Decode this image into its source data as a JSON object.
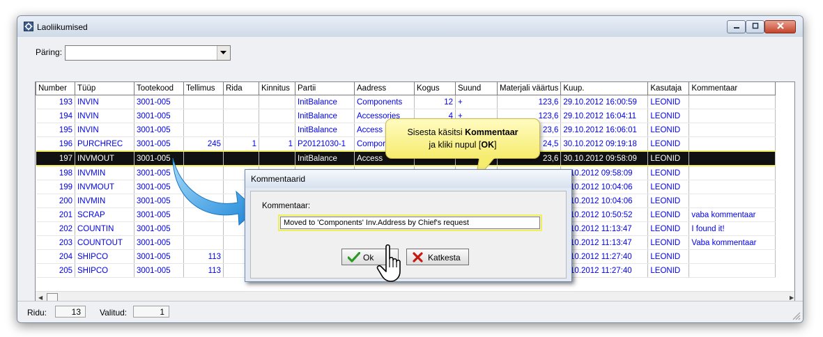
{
  "window": {
    "title": "Laoliikumised"
  },
  "query": {
    "label": "Päring:",
    "value": ""
  },
  "grid": {
    "columns": [
      "Number",
      "Tüüp",
      "Tootekood",
      "Tellimus",
      "Rida",
      "Kinnitus",
      "Partii",
      "Aadress",
      "Kogus",
      "Suund",
      "Materjali väärtus",
      "Kuup.",
      "Kasutaja",
      "Kommentaar"
    ],
    "rows": [
      [
        "193",
        "INVIN",
        "3001-005",
        "",
        "",
        "",
        "InitBalance",
        "Components",
        "12",
        "+",
        "123,6",
        "29.10.2012 16:00:59",
        "LEONID",
        ""
      ],
      [
        "194",
        "INVIN",
        "3001-005",
        "",
        "",
        "",
        "InitBalance",
        "Accessories",
        "4",
        "+",
        "123,6",
        "29.10.2012 16:04:11",
        "LEONID",
        ""
      ],
      [
        "195",
        "INVIN",
        "3001-005",
        "",
        "",
        "",
        "InitBalance",
        "Access",
        "",
        "",
        "23,6",
        "29.10.2012 16:06:01",
        "LEONID",
        ""
      ],
      [
        "196",
        "PURCHREC",
        "3001-005",
        "245",
        "1",
        "1",
        "P20121030-1",
        "Compor",
        "",
        "",
        "24,5",
        "30.10.2012 09:19:18",
        "LEONID",
        ""
      ],
      [
        "197",
        "INVMOUT",
        "3001-005",
        "",
        "",
        "",
        "InitBalance",
        "Access",
        "",
        "",
        "23,6",
        "30.10.2012 09:58:09",
        "LEONID",
        ""
      ],
      [
        "198",
        "INVMIN",
        "3001-005",
        "",
        "",
        "",
        "",
        "",
        "",
        "",
        "",
        "0.10.2012 09:58:09",
        "LEONID",
        ""
      ],
      [
        "199",
        "INVMOUT",
        "3001-005",
        "",
        "",
        "",
        "",
        "",
        "",
        "",
        "",
        "0.10.2012 10:04:06",
        "LEONID",
        ""
      ],
      [
        "200",
        "INVMIN",
        "3001-005",
        "",
        "",
        "",
        "",
        "",
        "",
        "",
        "",
        "0.10.2012 10:04:06",
        "LEONID",
        ""
      ],
      [
        "201",
        "SCRAP",
        "3001-005",
        "",
        "",
        "",
        "",
        "",
        "",
        "",
        "",
        "0.10.2012 10:50:52",
        "LEONID",
        "vaba kommentaar"
      ],
      [
        "202",
        "COUNTIN",
        "3001-005",
        "",
        "",
        "",
        "",
        "",
        "",
        "",
        "",
        "0.10.2012 11:13:47",
        "LEONID",
        "I found it!"
      ],
      [
        "203",
        "COUNTOUT",
        "3001-005",
        "",
        "",
        "",
        "",
        "",
        "",
        "",
        "",
        "0.10.2012 11:13:47",
        "LEONID",
        "Vaba kommentaar"
      ],
      [
        "204",
        "SHIPCO",
        "3001-005",
        "113",
        "",
        "",
        "",
        "",
        "",
        "",
        "",
        "0.10.2012 11:27:40",
        "LEONID",
        ""
      ],
      [
        "205",
        "SHIPCO",
        "3001-005",
        "113",
        "",
        "",
        "",
        "",
        "",
        "",
        "",
        "0.10.2012 11:27:40",
        "LEONID",
        ""
      ]
    ]
  },
  "status": {
    "rows_label": "Ridu:",
    "rows_value": "13",
    "selected_label": "Valitud:",
    "selected_value": "1"
  },
  "dialog": {
    "title": "Kommentaarid",
    "label": "Kommentaar:",
    "input_value": "Moved to 'Components' Inv.Address by Chief's request",
    "ok_label": "Ok",
    "cancel_label": "Katkesta"
  },
  "callout": {
    "line1_prefix": "Sisesta käsitsi ",
    "line1_bold": "Kommentaar",
    "line2_prefix": "ja kliki nupul [",
    "line2_bold": "OK",
    "line2_suffix": "]"
  },
  "colors": {
    "link_text": "#0000ee",
    "selection": "#111111",
    "highlight": "#f2f05a"
  }
}
